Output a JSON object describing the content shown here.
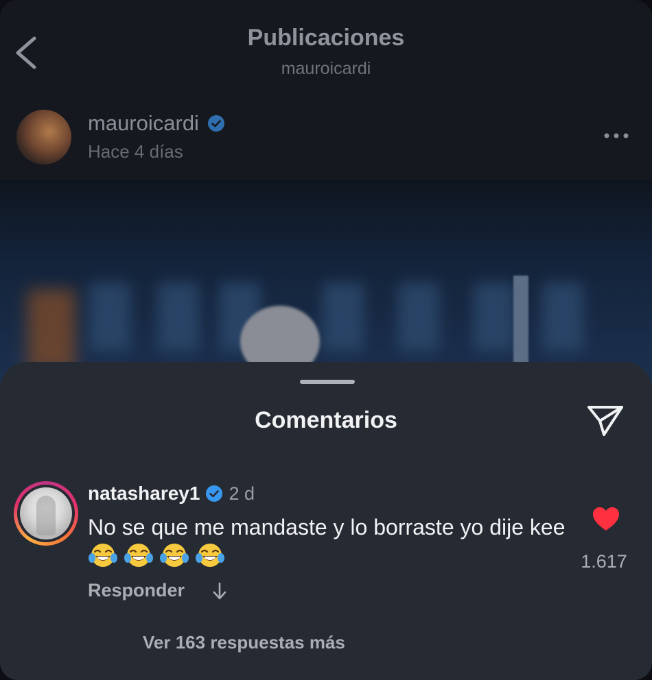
{
  "header": {
    "title": "Publicaciones",
    "subtitle": "mauroicardi"
  },
  "post": {
    "username": "mauroicardi",
    "verified": true,
    "time": "Hace 4 días"
  },
  "comments_sheet": {
    "title": "Comentarios",
    "comment": {
      "username": "natasharey1",
      "verified": true,
      "time": "2 d",
      "text": "No se que me mandaste y lo borraste yo dije kee",
      "emoji": "face-with-tears-of-joy",
      "emoji_count": 4,
      "reply_label": "Responder",
      "liked": true,
      "like_count": "1.617",
      "view_replies": "Ver 163 respuestas más"
    }
  },
  "colors": {
    "verified_blue": "#3897f0",
    "like_red": "#ff3040",
    "sheet_bg": "#262a32"
  }
}
